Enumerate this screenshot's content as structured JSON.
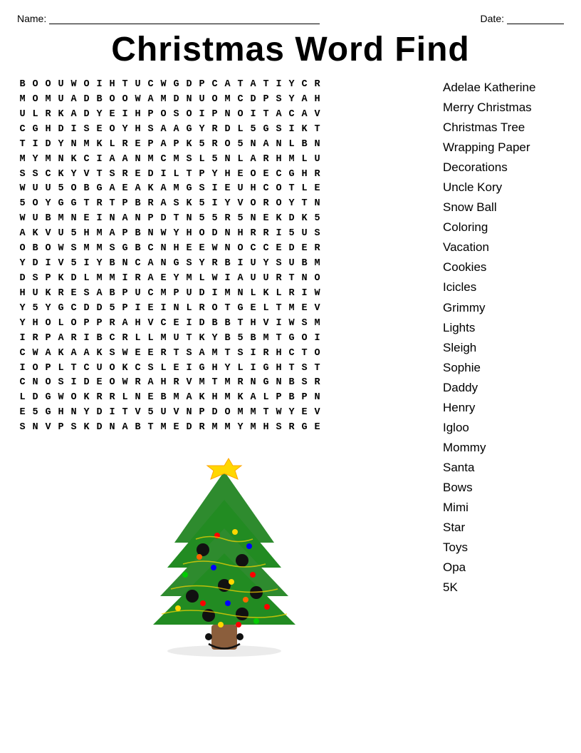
{
  "header": {
    "name_label": "Name:",
    "date_label": "Date:"
  },
  "title": "Christmas Word Find",
  "grid": [
    "B O O U W O I H T U C W G D P C A T A T I Y C R",
    "M O M U A D B O O W A M D N U O M C D P S Y A H",
    "U L R K A D Y E I H P O S O I P N O I T A C A V",
    "C G H D I S E O Y H S A A G Y R D L 5 G S I K T",
    "T I D Y N M K L R E P A P K 5 R O 5 N A N L B N",
    "M Y M N K C I A A N M C M S L 5 N L A R H M L U",
    "S S C K Y V T S R E D I L T P Y H E O E C G H R",
    "W U U 5 O B G A E A K A M G S I E U H C O T L E",
    "5 O Y G G T R T P B R A S K 5 I Y V O R O Y T N",
    "W U B M N E I N A N P D T N 5 5 R 5 N E K D K 5",
    "A K V U 5 H M A P B N W Y H O D N H R R I 5 U S",
    "O B O W S M M S G B C N H E E W N O C C E D E R",
    "Y D I V 5 I Y B N C A N G S Y R B I U Y S U B M",
    "D S P K D L M M I R A E Y M L W I A U U R T N O",
    "H U K R E S A B P U C M P U D I M N L K L R I W",
    "Y 5 Y G C D D 5 P I E I N L R O T G E L T M E V",
    "Y H O L O P P R A H V C E I D B B T H V I W S M",
    "I R P A R I B C R L L M U T K Y B 5 B M T G O I",
    "C W A K A A K S W E E R T S A M T S I R H C T O",
    "I O P L T C U O K C S L E I G H Y L I G H T S T",
    "C N O S I D E O W R A H R V M T M R N G N B S R",
    "L D G W O K R R L N E B M A K H M K A L P B P N",
    "E 5 G H N Y D I T V 5 U V N P D O M M T W Y E V",
    "S N V P S K D N A B T M E D R M M Y M H S R G E"
  ],
  "words": [
    "Adelae Katherine",
    "Merry Christmas",
    "Christmas Tree",
    "Wrapping Paper",
    "Decorations",
    "Uncle Kory",
    "Snow Ball",
    "Coloring",
    "Vacation",
    "Cookies",
    "Icicles",
    "Grimmy",
    "Lights",
    "Sleigh",
    "Sophie",
    "Daddy",
    "Henry",
    "Igloo",
    "Mommy",
    "Santa",
    "Bows",
    "Mimi",
    "Star",
    "Toys",
    "Opa",
    "5K"
  ]
}
